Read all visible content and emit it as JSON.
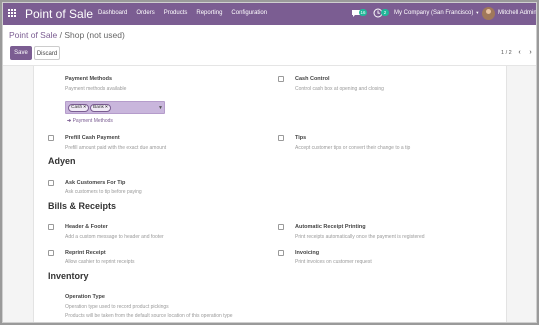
{
  "topbar": {
    "app_title": "Point of Sale",
    "menu": [
      "Dashboard",
      "Orders",
      "Products",
      "Reporting",
      "Configuration"
    ],
    "chat_count": "16",
    "activity_count": "2",
    "company": "My Company (San Francisco)",
    "user": "Mitchell Admin"
  },
  "breadcrumb": {
    "parent": "Point of Sale",
    "separator": "/",
    "current": "Shop (not used)"
  },
  "buttons": {
    "save": "Save",
    "discard": "Discard"
  },
  "pager": {
    "value": "1 / 2",
    "prev": "‹",
    "next": "›"
  },
  "payment_methods": {
    "label": "Payment Methods",
    "desc": "Payment methods available",
    "tags": [
      "Cash",
      "Bank"
    ],
    "tag_remove": "×",
    "link": "Payment Methods"
  },
  "cash_control": {
    "label": "Cash Control",
    "desc": "Control cash box at opening and closing"
  },
  "prefill_cash": {
    "label": "Prefill Cash Payment",
    "desc": "Prefill amount paid with the exact due amount"
  },
  "tips": {
    "label": "Tips",
    "desc": "Accept customer tips or convert their change to a tip"
  },
  "sections": {
    "adyen": "Adyen",
    "bills": "Bills & Receipts",
    "inventory": "Inventory"
  },
  "ask_tip": {
    "label": "Ask Customers For Tip",
    "desc": "Ask customers to tip before paying"
  },
  "header_footer": {
    "label": "Header & Footer",
    "desc": "Add a custom message to header and footer"
  },
  "auto_receipt": {
    "label": "Automatic Receipt Printing",
    "desc": "Print receipts automatically once the payment is registered"
  },
  "reprint": {
    "label": "Reprint Receipt",
    "desc": "Allow cashier to reprint receipts"
  },
  "invoicing": {
    "label": "Invoicing",
    "desc": "Print invoices on customer request"
  },
  "operation_type": {
    "label": "Operation Type",
    "desc1": "Operation type used to record product pickings",
    "desc2": "Products will be taken from the default source location of this operation type"
  },
  "colors": {
    "brand": "#7b5d92",
    "badge": "#21b799"
  }
}
